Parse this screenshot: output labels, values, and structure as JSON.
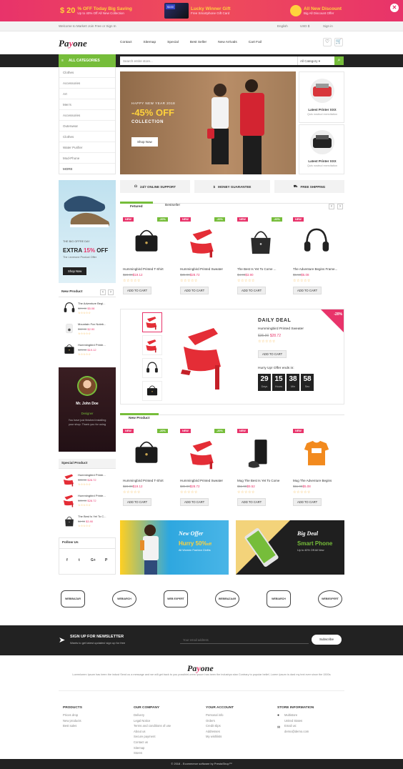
{
  "promo": {
    "item1_big": "20",
    "item1_title": "% OFF Today Big Saving",
    "item1_sub": "Up to 40% Off All New Collection",
    "item2_badge": "$100",
    "item2_title": "Lucky Winner Gift",
    "item2_sub": "Free Smartphone Gift Card",
    "item3_title": "All New Discount",
    "item3_sub": "Big All Discount Offer",
    "close_label": "✕"
  },
  "topbar": {
    "welcome": "Welcome to Market! Join Free or Sign In",
    "language": "English",
    "currency": "USD $",
    "signin": "Sign in"
  },
  "header": {
    "logo_pre": "Pa",
    "logo_mark": "y",
    "logo_post": "one",
    "nav": [
      "Contact",
      "Sitemap",
      "Special",
      "Best Seller",
      "New Arrivals",
      "Cart Fail"
    ],
    "wishlist_icon": "heart-icon",
    "cart_icon": "cart-icon",
    "cart_count": "0"
  },
  "catbar": {
    "button_label": "ALL CATEGORIES",
    "search_placeholder": "Search entire store...",
    "search_category": "All Category"
  },
  "sidebar": {
    "categories": [
      "Clothes",
      "Accessories",
      "Art",
      "Men's",
      "Accessories",
      "Outerwear",
      "Clothes",
      "Water Purifier",
      "Mod-Phone",
      "MORE"
    ]
  },
  "hero": {
    "subtitle": "HAPPY NEW YEAR 2018",
    "discount": "-45% OFF",
    "collection": "COLLECTION",
    "button": "Shop Now"
  },
  "side_products": [
    {
      "title": "Latest Printer XXX",
      "sub": "Quis nostrud exercitation"
    },
    {
      "title": "Latest Printer XXX",
      "sub": "Quis nostrud exercitation"
    }
  ],
  "features": [
    {
      "icon": "headset-icon",
      "label": "24/7 ONLINE SUPPORT"
    },
    {
      "icon": "money-bag-icon",
      "label": "MONEY GUARANTEE"
    },
    {
      "icon": "truck-icon",
      "label": "FREE SHIPPING"
    }
  ],
  "left_banner": {
    "small": "THE BIG OFFRE DAY",
    "title_pre": "EXTRA ",
    "title_pct": "15%",
    "title_post": " OFF",
    "sub": "The Leverone Product Offer",
    "button": "Shop Now"
  },
  "tabs": [
    "Fetured",
    "Bestseller"
  ],
  "featured_products": [
    {
      "title": "Hummingbird Printed T-Shirt",
      "old": "$23.90",
      "new": "$19.12",
      "tag": "NEW",
      "off": "-20%",
      "img": "handbag"
    },
    {
      "title": "Hummingbird Printed Sweater",
      "old": "$35.90",
      "new": "$28.72",
      "tag": "NEW",
      "off": "-20%",
      "img": "heel"
    },
    {
      "title": "The Best Is Yet To Come ...",
      "old": "$4.90",
      "new": "$3.90",
      "tag": "NEW",
      "off": "-20%",
      "img": "tote"
    },
    {
      "title": "The Adventure Begins Frame...",
      "old": "$6.50",
      "new": "$5.08",
      "tag": "NEW",
      "off": "",
      "img": "headphones"
    }
  ],
  "add_to_cart": "ADD TO CART",
  "left_new": {
    "title": "New Product",
    "items": [
      {
        "title": "The Adventure Begi...",
        "old": "$29.90",
        "new": "$5.08",
        "img": "headphones"
      },
      {
        "title": "Mountain Fox Noteb...",
        "old": "$12.90",
        "new": "$2.90",
        "img": "speaker"
      },
      {
        "title": "Hummingbird Printe...",
        "old": "$23.90",
        "new": "$19.12",
        "img": "handbag"
      }
    ]
  },
  "deal": {
    "off": "-20%",
    "title": "DAILY DEAL",
    "product": "Hummingbird Printed Sweater",
    "old": "$35.90",
    "new": "$28.72",
    "button": "ADD TO CART",
    "hurry": "Hurry Up! Offer ends in:",
    "timer": [
      {
        "n": "29",
        "u": "Days"
      },
      {
        "n": "15",
        "u": "Hours"
      },
      {
        "n": "38",
        "u": "Min"
      },
      {
        "n": "58",
        "u": "Sec"
      }
    ]
  },
  "testimonial": {
    "name": "Mr. John Doe",
    "role": "Designer",
    "text": "You have just finished installing your shop. Thank you for using"
  },
  "new_products_title": "New Product",
  "new_products": [
    {
      "title": "Hummingbird Printed T-Shirt",
      "old": "$23.90",
      "new": "$19.12",
      "tag": "NEW",
      "off": "-20%",
      "img": "handbag"
    },
    {
      "title": "Hummingbird Printed Sweater",
      "old": "$35.90",
      "new": "$28.72",
      "tag": "NEW",
      "off": "-20%",
      "img": "heel"
    },
    {
      "title": "Mug The Best Is Yet To Come",
      "old": "$11.90",
      "new": "$9.52",
      "tag": "NEW",
      "off": "",
      "img": "console"
    },
    {
      "title": "Mug The Adventure Begins",
      "old": "$11.90",
      "new": "$5.08",
      "tag": "NEW",
      "off": "",
      "img": "tshirt"
    }
  ],
  "special": {
    "title": "Special Product",
    "items": [
      {
        "title": "Hummingbird Printe...",
        "old": "$35.90",
        "new": "$28.72",
        "img": "heel"
      },
      {
        "title": "Hummingbird Printe...",
        "old": "$35.90",
        "new": "$28.72",
        "img": "heel"
      },
      {
        "title": "The Best Is Yet To C...",
        "old": "$4.90",
        "new": "$3.90",
        "img": "tote"
      }
    ]
  },
  "follow": {
    "title": "Follow Us",
    "icons": [
      "f",
      "t",
      "G+",
      "P"
    ]
  },
  "banner_left": {
    "title": "New Offer",
    "sub_pre": "Hurry ",
    "sub_pct": "50%",
    "sub_post": "off",
    "small": "All Women Fashion Cloths"
  },
  "banner_right": {
    "title": "Big Deal",
    "sub": "Smart Phone",
    "small": "Up to 40% Off All New"
  },
  "brands": [
    "WEBIBAZAR",
    "WEBIARCH",
    "WEB EXPERT",
    "WEBIBAZAAR",
    "WEBIARCH",
    "WEBIEXPERT"
  ],
  "newsletter": {
    "title": "SIGN UP FOR NEWSLETTER",
    "sub": "Wants to get latest updates! sign up for free",
    "placeholder": "Your email address",
    "button": "Subscribe"
  },
  "footer": {
    "about": "Loremlorem Ipsum has been the indust Send us a message and we will get back to you possibleLorem Ipsum has been the industrys stan Contrary to popular belief, Lorem Ipsum is dard my text ever since the 1500s",
    "cols": [
      {
        "title": "PRODUCTS",
        "links": [
          "Prices drop",
          "New products",
          "Best sales"
        ]
      },
      {
        "title": "OUR COMPANY",
        "links": [
          "Delivery",
          "Legal Notice",
          "Terms and conditions of use",
          "About us",
          "Secure payment",
          "Contact us",
          "Sitemap",
          "Stores"
        ]
      },
      {
        "title": "YOUR ACCOUNT",
        "links": [
          "Personal info",
          "Orders",
          "Credit slips",
          "Addresses",
          "My wishlists"
        ]
      },
      {
        "title": "STORE INFORMATION",
        "links": [
          "Multistore",
          "United States",
          "Email us:",
          "demo@demo.com"
        ]
      }
    ],
    "copyright": "© 2018 - Ecommerce software by PrestaShop™"
  }
}
